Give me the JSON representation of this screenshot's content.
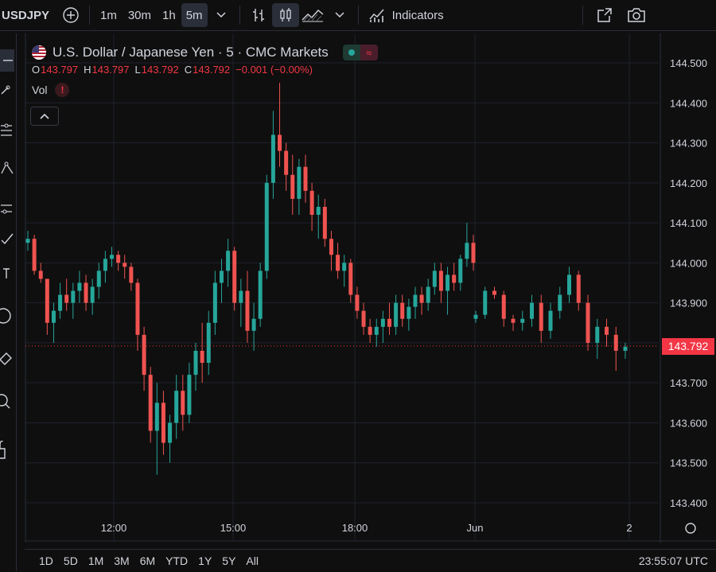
{
  "toolbar": {
    "symbol": "USDJPY",
    "intervals": [
      "1m",
      "30m",
      "1h",
      "5m"
    ],
    "active_interval": "5m",
    "indicators_label": "Indicators"
  },
  "legend": {
    "title": "U.S. Dollar / Japanese Yen · 5 · CMC Markets",
    "o_label": "O",
    "o_value": "143.797",
    "h_label": "H",
    "h_value": "143.797",
    "l_label": "L",
    "l_value": "143.792",
    "c_label": "C",
    "c_value": "143.792",
    "change": "−0.001 (−0.00%)",
    "vol_label": "Vol",
    "vol_warning": "!"
  },
  "price_axis": {
    "ticks": [
      "144.500",
      "144.400",
      "144.300",
      "144.200",
      "144.100",
      "144.000",
      "143.900",
      "143.800",
      "143.700",
      "143.600",
      "143.500",
      "143.400"
    ],
    "last_price": "143.792"
  },
  "time_axis": {
    "ticks": [
      "12:00",
      "15:00",
      "18:00",
      "Jun",
      "2"
    ]
  },
  "bottom": {
    "ranges": [
      "1D",
      "5D",
      "1M",
      "3M",
      "6M",
      "YTD",
      "1Y",
      "5Y",
      "All"
    ],
    "clock": "23:55:07 UTC"
  },
  "colors": {
    "up": "#26a69a",
    "down": "#ef5350",
    "background": "#0f0f0f",
    "price_tag": "#f23645"
  },
  "chart_data": {
    "type": "candlestick",
    "yrange": [
      143.38,
      144.52
    ],
    "last_price": 143.792,
    "candles": [
      [
        144.05,
        144.08,
        144.03,
        144.06
      ],
      [
        144.06,
        144.07,
        143.97,
        143.98
      ],
      [
        143.98,
        144.0,
        143.95,
        143.96
      ],
      [
        143.96,
        143.96,
        143.82,
        143.85
      ],
      [
        143.85,
        143.9,
        143.8,
        143.88
      ],
      [
        143.88,
        143.95,
        143.86,
        143.92
      ],
      [
        143.92,
        143.96,
        143.88,
        143.9
      ],
      [
        143.9,
        143.95,
        143.86,
        143.93
      ],
      [
        143.93,
        143.98,
        143.9,
        143.95
      ],
      [
        143.95,
        143.97,
        143.88,
        143.9
      ],
      [
        143.9,
        143.96,
        143.87,
        143.94
      ],
      [
        143.94,
        144.0,
        143.91,
        143.98
      ],
      [
        143.98,
        144.03,
        143.95,
        144.01
      ],
      [
        144.01,
        144.04,
        143.99,
        144.02
      ],
      [
        144.02,
        144.03,
        143.98,
        144.0
      ],
      [
        144.0,
        144.02,
        143.96,
        143.99
      ],
      [
        143.99,
        144.0,
        143.93,
        143.95
      ],
      [
        143.95,
        143.96,
        143.78,
        143.82
      ],
      [
        143.82,
        143.84,
        143.68,
        143.72
      ],
      [
        143.72,
        143.74,
        143.55,
        143.58
      ],
      [
        143.58,
        143.7,
        143.47,
        143.65
      ],
      [
        143.65,
        143.68,
        143.52,
        143.55
      ],
      [
        143.55,
        143.62,
        143.5,
        143.6
      ],
      [
        143.6,
        143.72,
        143.56,
        143.68
      ],
      [
        143.68,
        143.72,
        143.58,
        143.62
      ],
      [
        143.62,
        143.75,
        143.6,
        143.72
      ],
      [
        143.72,
        143.8,
        143.68,
        143.78
      ],
      [
        143.78,
        143.85,
        143.7,
        143.75
      ],
      [
        143.75,
        143.88,
        143.72,
        143.85
      ],
      [
        143.85,
        143.98,
        143.82,
        143.95
      ],
      [
        143.95,
        144.01,
        143.9,
        143.98
      ],
      [
        143.98,
        144.06,
        143.94,
        144.03
      ],
      [
        144.03,
        144.04,
        143.88,
        143.9
      ],
      [
        143.9,
        143.96,
        143.84,
        143.93
      ],
      [
        143.93,
        143.98,
        143.8,
        143.83
      ],
      [
        143.83,
        143.9,
        143.78,
        143.86
      ],
      [
        143.86,
        144.0,
        143.84,
        143.98
      ],
      [
        143.98,
        144.22,
        143.96,
        144.2
      ],
      [
        144.2,
        144.38,
        144.16,
        144.32
      ],
      [
        144.32,
        144.45,
        144.24,
        144.28
      ],
      [
        144.28,
        144.3,
        144.18,
        144.22
      ],
      [
        144.22,
        144.27,
        144.12,
        144.16
      ],
      [
        144.16,
        144.26,
        144.12,
        144.24
      ],
      [
        144.24,
        144.27,
        144.15,
        144.18
      ],
      [
        144.18,
        144.2,
        144.08,
        144.12
      ],
      [
        144.12,
        144.17,
        144.06,
        144.14
      ],
      [
        144.14,
        144.16,
        144.04,
        144.06
      ],
      [
        144.06,
        144.08,
        143.98,
        144.02
      ],
      [
        144.02,
        144.05,
        143.96,
        143.98
      ],
      [
        143.98,
        144.02,
        143.94,
        144.0
      ],
      [
        144.0,
        144.01,
        143.9,
        143.92
      ],
      [
        143.92,
        143.94,
        143.86,
        143.88
      ],
      [
        143.88,
        143.9,
        143.82,
        143.84
      ],
      [
        143.84,
        143.86,
        143.8,
        143.82
      ],
      [
        143.82,
        143.86,
        143.79,
        143.84
      ],
      [
        143.84,
        143.88,
        143.8,
        143.86
      ],
      [
        143.86,
        143.9,
        143.82,
        143.84
      ],
      [
        143.84,
        143.92,
        143.82,
        143.9
      ],
      [
        143.9,
        143.92,
        143.84,
        143.86
      ],
      [
        143.86,
        143.91,
        143.83,
        143.89
      ],
      [
        143.89,
        143.94,
        143.86,
        143.92
      ],
      [
        143.92,
        143.94,
        143.87,
        143.9
      ],
      [
        143.9,
        143.96,
        143.88,
        143.94
      ],
      [
        143.94,
        144.0,
        143.92,
        143.98
      ],
      [
        143.98,
        144.0,
        143.9,
        143.93
      ],
      [
        143.93,
        143.99,
        143.87,
        143.97
      ],
      [
        143.97,
        144.0,
        143.93,
        143.95
      ],
      [
        143.95,
        144.02,
        143.93,
        144.01
      ],
      [
        144.01,
        144.1,
        143.99,
        144.05
      ],
      [
        144.05,
        144.07,
        143.98,
        144.0
      ],
      [
        143.86,
        143.88,
        143.85,
        143.87
      ],
      [
        143.87,
        143.94,
        143.86,
        143.93
      ],
      [
        143.93,
        143.94,
        143.91,
        143.92
      ],
      [
        143.92,
        143.93,
        143.84,
        143.86
      ],
      [
        143.86,
        143.87,
        143.83,
        143.85
      ],
      [
        143.85,
        143.88,
        143.83,
        143.86
      ],
      [
        143.86,
        143.92,
        143.84,
        143.9
      ],
      [
        143.9,
        143.92,
        143.8,
        143.83
      ],
      [
        143.83,
        143.9,
        143.81,
        143.88
      ],
      [
        143.88,
        143.94,
        143.86,
        143.92
      ],
      [
        143.92,
        143.99,
        143.9,
        143.97
      ],
      [
        143.97,
        143.98,
        143.88,
        143.9
      ],
      [
        143.9,
        143.92,
        143.78,
        143.8
      ],
      [
        143.8,
        143.86,
        143.76,
        143.84
      ],
      [
        143.84,
        143.86,
        143.79,
        143.82
      ],
      [
        143.82,
        143.84,
        143.73,
        143.78
      ],
      [
        143.78,
        143.8,
        143.76,
        143.79
      ]
    ]
  }
}
